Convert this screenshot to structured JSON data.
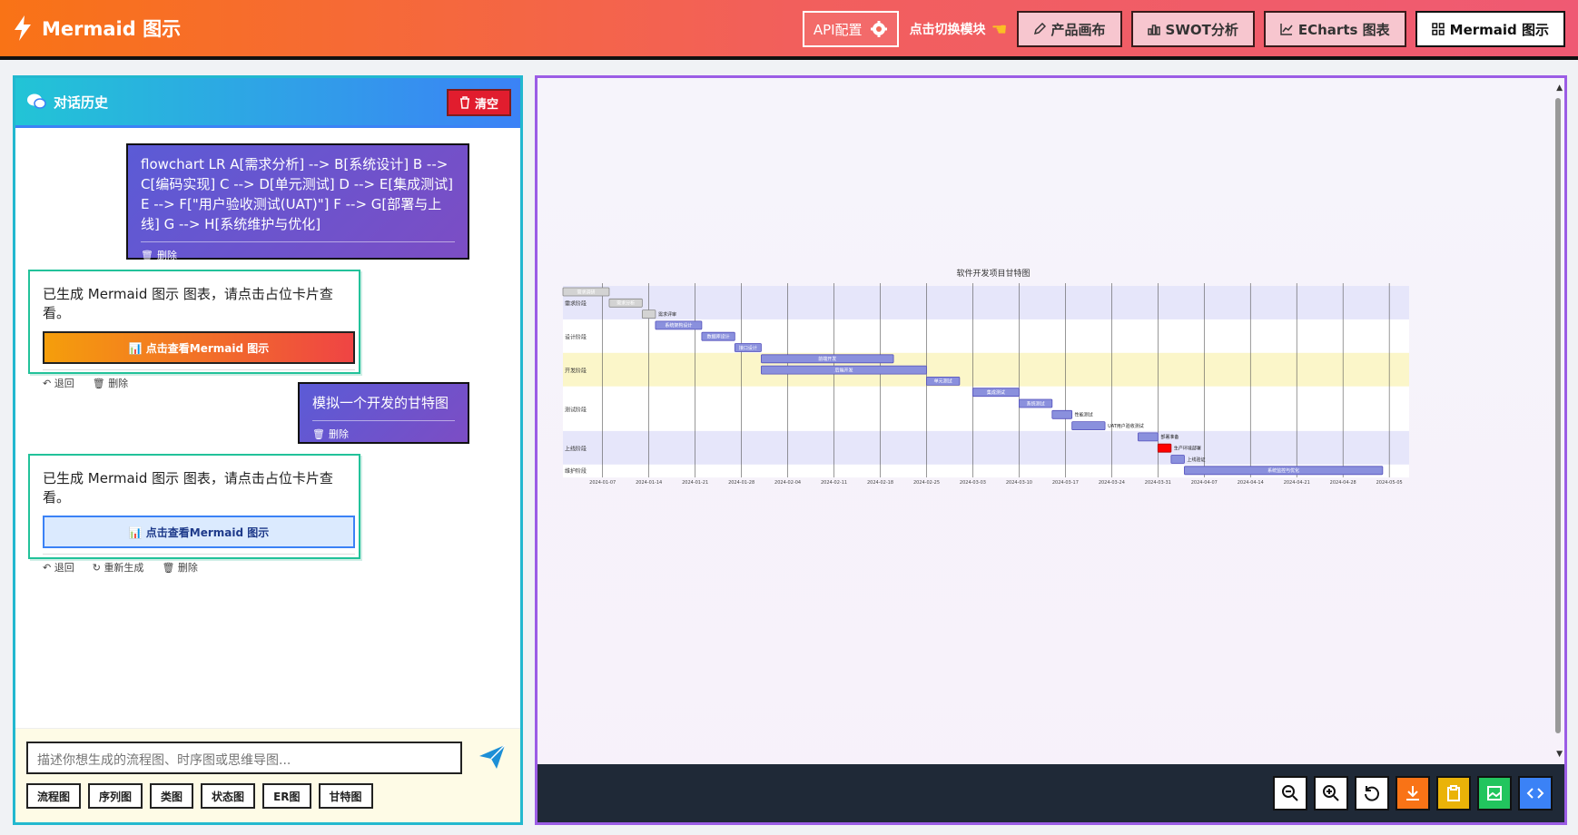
{
  "header": {
    "title": "Mermaid 图示",
    "api_label": "API配置",
    "switch_hint": "点击切换模块",
    "modules": [
      {
        "label": "产品画布",
        "icon": "pen-icon"
      },
      {
        "label": "SWOT分析",
        "icon": "bar-chart-icon"
      },
      {
        "label": "ECharts 图表",
        "icon": "line-chart-icon"
      },
      {
        "label": "Mermaid 图示",
        "icon": "grid-icon"
      }
    ],
    "active_module": "Mermaid 图示"
  },
  "history": {
    "title": "对话历史",
    "clear_label": "清空",
    "messages": [
      {
        "role": "user",
        "text": "flowchart LR A[需求分析] --> B[系统设计] B --> C[编码实现] C --> D[单元测试] D --> E[集成测试] E --> F[\"用户验收测试(UAT)\"] F --> G[部署与上线] G --> H[系统维护与优化]",
        "delete": "删除"
      },
      {
        "role": "bot",
        "text": "已生成 Mermaid 图示 图表，请点击占位卡片查看。",
        "button": "📊 点击查看Mermaid 图示",
        "actions": [
          "退回",
          "删除"
        ]
      },
      {
        "role": "user",
        "text": "模拟一个开发的甘特图",
        "delete": "删除"
      },
      {
        "role": "bot",
        "text": "已生成 Mermaid 图示 图表，请点击占位卡片查看。",
        "button": "📊 点击查看Mermaid 图示",
        "actions": [
          "退回",
          "重新生成",
          "删除"
        ]
      }
    ]
  },
  "composer": {
    "placeholder": "描述你想生成的流程图、时序图或思维导图...",
    "chips": [
      "流程图",
      "序列图",
      "类图",
      "状态图",
      "ER图",
      "甘特图"
    ]
  },
  "chart_data": {
    "type": "gantt",
    "title": "软件开发项目甘特图",
    "sections": [
      "需求阶段",
      "设计阶段",
      "开发阶段",
      "测试阶段",
      "上线阶段",
      "维护阶段"
    ],
    "tasks": [
      {
        "name": "需求调研",
        "section": "需求阶段",
        "start": "2024-01-01",
        "end": "2024-01-08",
        "status": "done"
      },
      {
        "name": "需求分析",
        "section": "需求阶段",
        "start": "2024-01-08",
        "end": "2024-01-13",
        "status": "done"
      },
      {
        "name": "需求评审",
        "section": "需求阶段",
        "start": "2024-01-13",
        "end": "2024-01-15",
        "status": "done"
      },
      {
        "name": "系统架构设计",
        "section": "设计阶段",
        "start": "2024-01-15",
        "end": "2024-01-22",
        "status": "active"
      },
      {
        "name": "数据库设计",
        "section": "设计阶段",
        "start": "2024-01-22",
        "end": "2024-01-27",
        "status": "active"
      },
      {
        "name": "接口设计",
        "section": "设计阶段",
        "start": "2024-01-27",
        "end": "2024-01-31",
        "status": "active"
      },
      {
        "name": "前端开发",
        "section": "开发阶段",
        "start": "2024-01-31",
        "end": "2024-02-20",
        "status": "active"
      },
      {
        "name": "后端开发",
        "section": "开发阶段",
        "start": "2024-01-31",
        "end": "2024-02-25",
        "status": "active"
      },
      {
        "name": "单元测试",
        "section": "开发阶段",
        "start": "2024-02-25",
        "end": "2024-03-01",
        "status": "active"
      },
      {
        "name": "集成测试",
        "section": "测试阶段",
        "start": "2024-03-03",
        "end": "2024-03-10",
        "status": "active"
      },
      {
        "name": "系统测试",
        "section": "测试阶段",
        "start": "2024-03-10",
        "end": "2024-03-15",
        "status": "active"
      },
      {
        "name": "性能测试",
        "section": "测试阶段",
        "start": "2024-03-15",
        "end": "2024-03-18",
        "status": "active"
      },
      {
        "name": "UAT用户验收测试",
        "section": "测试阶段",
        "start": "2024-03-18",
        "end": "2024-03-23",
        "status": "active"
      },
      {
        "name": "部署准备",
        "section": "上线阶段",
        "start": "2024-03-28",
        "end": "2024-03-31",
        "status": "active"
      },
      {
        "name": "生产环境部署",
        "section": "上线阶段",
        "start": "2024-03-31",
        "end": "2024-04-02",
        "status": "crit"
      },
      {
        "name": "上线验证",
        "section": "上线阶段",
        "start": "2024-04-02",
        "end": "2024-04-04",
        "status": "active"
      },
      {
        "name": "系统监控与优化",
        "section": "维护阶段",
        "start": "2024-04-04",
        "end": "2024-05-04",
        "status": "active"
      }
    ],
    "x_ticks": [
      "2024-01-07",
      "2024-01-14",
      "2024-01-21",
      "2024-01-28",
      "2024-02-04",
      "2024-02-11",
      "2024-02-18",
      "2024-02-25",
      "2024-03-03",
      "2024-03-10",
      "2024-03-17",
      "2024-03-24",
      "2024-03-31",
      "2024-04-07",
      "2024-04-14",
      "2024-04-21",
      "2024-04-28",
      "2024-05-05"
    ],
    "x_range": [
      "2024-01-01",
      "2024-05-08"
    ],
    "colors": {
      "done": "#d3d3d3",
      "active": "#8a90dd",
      "crit": "#ff0000",
      "section_a": "#e6e6fa",
      "section_b": "#fbf6c9",
      "section_c": "#ffffff"
    }
  },
  "toolbar": {
    "buttons": [
      {
        "name": "zoom-out-button",
        "icon": "zoom-out-icon",
        "bg": "#ffffff"
      },
      {
        "name": "zoom-in-button",
        "icon": "zoom-in-icon",
        "bg": "#ffffff"
      },
      {
        "name": "reset-button",
        "icon": "reset-icon",
        "bg": "#ffffff"
      },
      {
        "name": "download-button",
        "icon": "download-icon",
        "bg": "#f97316"
      },
      {
        "name": "copy-button",
        "icon": "clipboard-icon",
        "bg": "#eab308"
      },
      {
        "name": "export-image-button",
        "icon": "image-icon",
        "bg": "#22c55e"
      },
      {
        "name": "code-button",
        "icon": "code-icon",
        "bg": "#3b82f6"
      }
    ]
  }
}
